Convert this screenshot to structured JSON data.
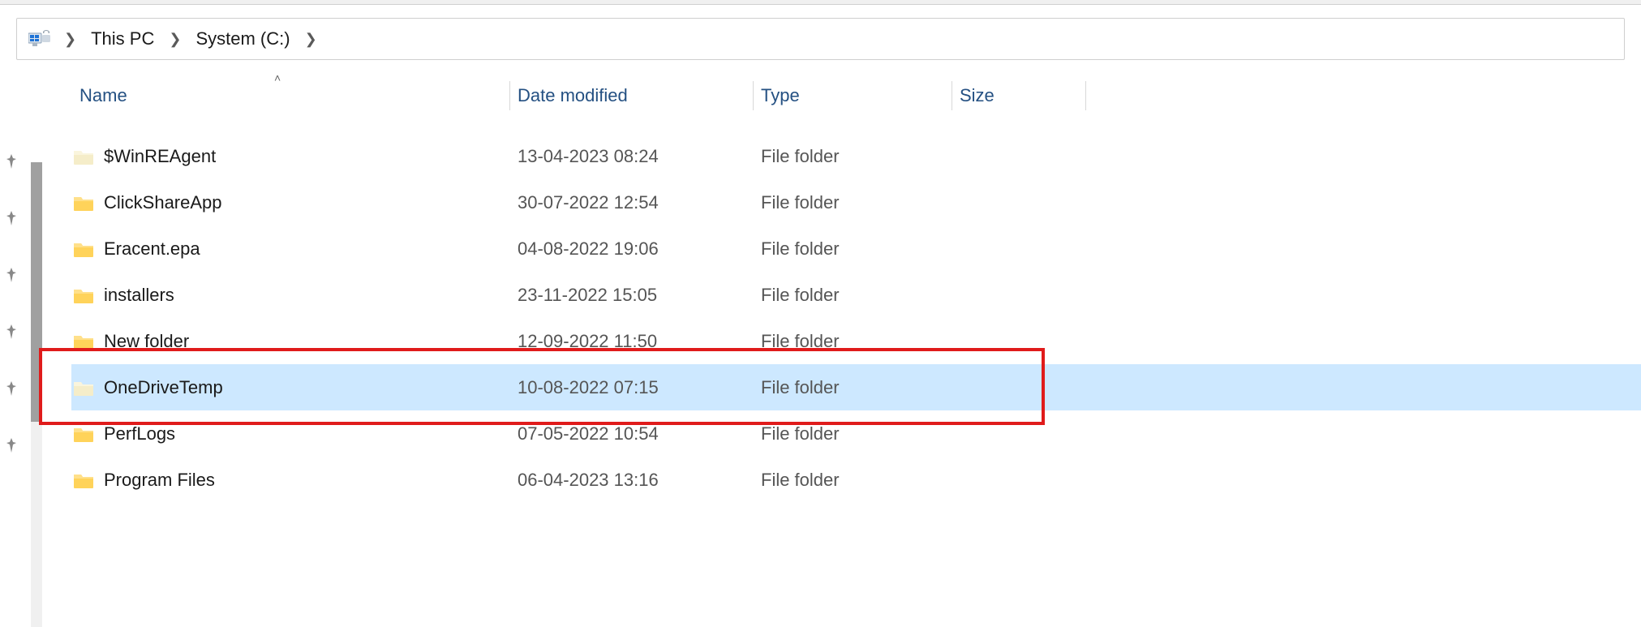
{
  "breadcrumb": {
    "items": [
      {
        "label": "This PC"
      },
      {
        "label": "System (C:)"
      }
    ]
  },
  "columns": {
    "name": "Name",
    "date": "Date modified",
    "type": "Type",
    "size": "Size"
  },
  "rows": [
    {
      "name": "$WinREAgent",
      "date": "13-04-2023 08:24",
      "type": "File folder",
      "size": "",
      "iconStyle": "light",
      "selected": false
    },
    {
      "name": "ClickShareApp",
      "date": "30-07-2022 12:54",
      "type": "File folder",
      "size": "",
      "iconStyle": "normal",
      "selected": false
    },
    {
      "name": "Eracent.epa",
      "date": "04-08-2022 19:06",
      "type": "File folder",
      "size": "",
      "iconStyle": "normal",
      "selected": false
    },
    {
      "name": "installers",
      "date": "23-11-2022 15:05",
      "type": "File folder",
      "size": "",
      "iconStyle": "normal",
      "selected": false
    },
    {
      "name": "New folder",
      "date": "12-09-2022 11:50",
      "type": "File folder",
      "size": "",
      "iconStyle": "normal",
      "selected": false
    },
    {
      "name": "OneDriveTemp",
      "date": "10-08-2022 07:15",
      "type": "File folder",
      "size": "",
      "iconStyle": "light",
      "selected": true
    },
    {
      "name": "PerfLogs",
      "date": "07-05-2022 10:54",
      "type": "File folder",
      "size": "",
      "iconStyle": "normal",
      "selected": false
    },
    {
      "name": "Program Files",
      "date": "06-04-2023 13:16",
      "type": "File folder",
      "size": "",
      "iconStyle": "normal",
      "selected": false
    }
  ],
  "annotation": {
    "highlight_row_index": 5
  }
}
